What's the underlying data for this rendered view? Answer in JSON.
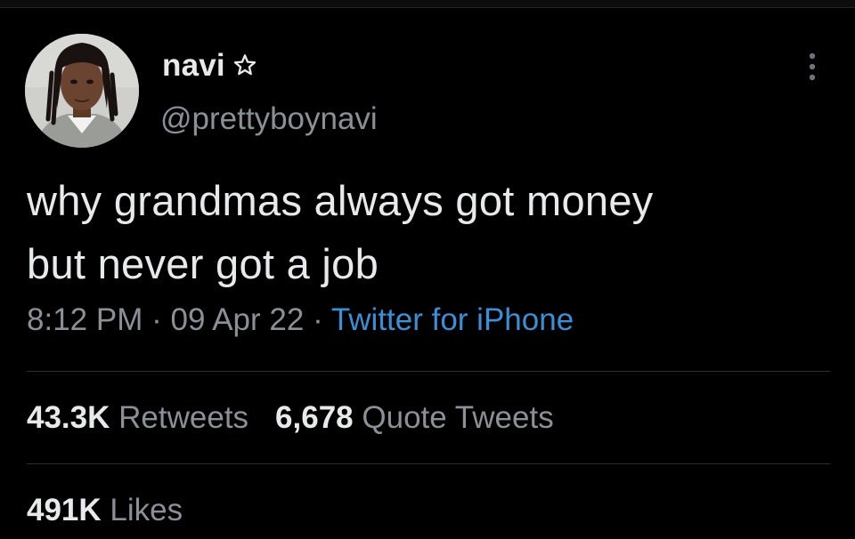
{
  "tweet": {
    "author": {
      "display_name": "navi",
      "handle": "@prettyboynavi"
    },
    "text_lines": [
      "why grandmas always got money",
      "but never got a job"
    ],
    "meta": {
      "time": "8:12 PM",
      "separator": "·",
      "date": "09 Apr 22",
      "source": "Twitter for iPhone"
    },
    "stats": {
      "retweets_count": "43.3K",
      "retweets_label": "Retweets",
      "quote_tweets_count": "6,678",
      "quote_tweets_label": "Quote Tweets",
      "likes_count": "491K",
      "likes_label": "Likes"
    }
  },
  "icons": {
    "name_badge": "star-outline-icon",
    "menu": "more-options-icon"
  },
  "colors": {
    "background": "#000000",
    "primary_text": "#e7e9ea",
    "secondary_text": "#8b9096",
    "link": "#3a8fd6",
    "divider": "#2b2d2f"
  }
}
